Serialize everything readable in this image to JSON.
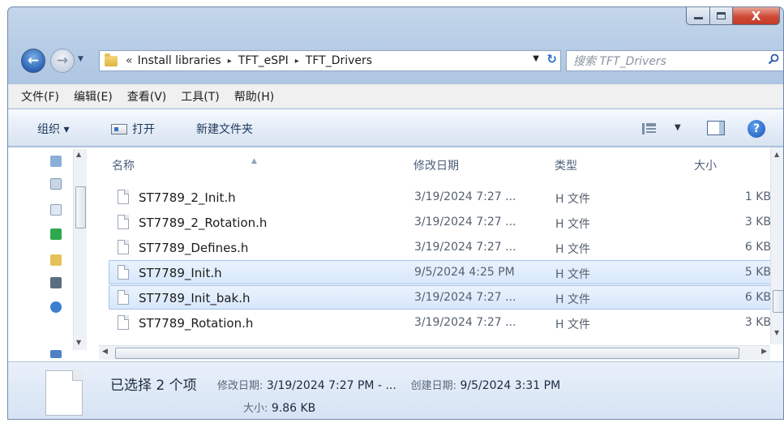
{
  "window": {
    "caption_buttons": {
      "minimize_icon": "minimize-icon",
      "maximize_icon": "maximize-icon",
      "close_glyph": "X"
    }
  },
  "address": {
    "prefix": "«",
    "crumbs": [
      "Install libraries",
      "TFT_eSPI",
      "TFT_Drivers"
    ],
    "separator": "▸",
    "search_placeholder": "搜索 TFT_Drivers"
  },
  "menu": [
    "文件(F)",
    "编辑(E)",
    "查看(V)",
    "工具(T)",
    "帮助(H)"
  ],
  "commands": {
    "organize": "组织 ▾",
    "open": "打开",
    "new_folder": "新建文件夹"
  },
  "columns": {
    "name": "名称",
    "date": "修改日期",
    "type": "类型",
    "size": "大小"
  },
  "files": [
    {
      "name": "ST7789_2_Init.h",
      "date": "3/19/2024 7:27 ...",
      "type": "H 文件",
      "size": "1 KB",
      "selected": false
    },
    {
      "name": "ST7789_2_Rotation.h",
      "date": "3/19/2024 7:27 ...",
      "type": "H 文件",
      "size": "3 KB",
      "selected": false
    },
    {
      "name": "ST7789_Defines.h",
      "date": "3/19/2024 7:27 ...",
      "type": "H 文件",
      "size": "6 KB",
      "selected": false
    },
    {
      "name": "ST7789_Init.h",
      "date": "9/5/2024 4:25 PM",
      "type": "H 文件",
      "size": "5 KB",
      "selected": true
    },
    {
      "name": "ST7789_Init_bak.h",
      "date": "3/19/2024 7:27 ...",
      "type": "H 文件",
      "size": "6 KB",
      "selected": true
    },
    {
      "name": "ST7789_Rotation.h",
      "date": "3/19/2024 7:27 ...",
      "type": "H 文件",
      "size": "3 KB",
      "selected": false
    }
  ],
  "details": {
    "selection": "已选择 2 个项",
    "modified_label": "修改日期:",
    "modified_value": "3/19/2024 7:27 PM - ...",
    "created_label": "创建日期:",
    "created_value": "9/5/2024 3:31 PM",
    "size_label": "大小:",
    "size_value": "9.86 KB"
  },
  "colors": {
    "selection_bg": "#d7e7fb",
    "selection_border": "#a4c3ea",
    "accent": "#2c63b3"
  }
}
